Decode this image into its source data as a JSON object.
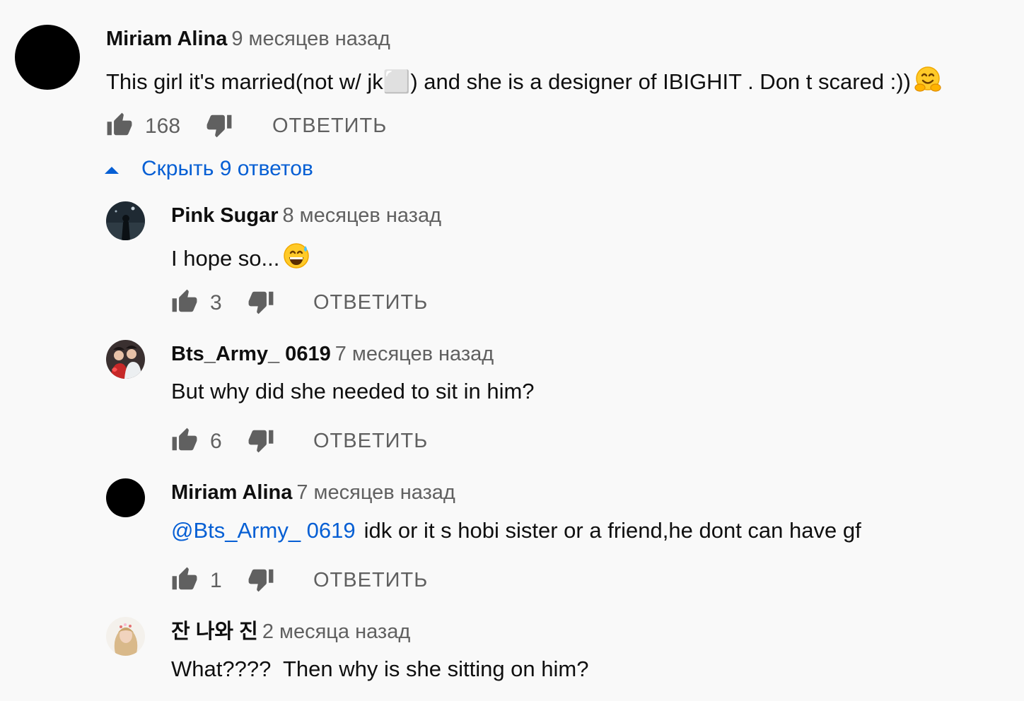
{
  "top_comment": {
    "author": "Miriam Alina",
    "time": "9 месяцев назад",
    "text": "This girl it's married(not w/ jk⬜) and she is a designer of IBIGHIT . Don t scared :))",
    "emoji": "hugging-face-emoji",
    "likes": "168",
    "reply_label": "ОТВЕТИТЬ"
  },
  "replies_toggle": {
    "label": "Скрыть 9 ответов"
  },
  "replies": [
    {
      "author": "Pink Sugar",
      "time": "8 месяцев назад",
      "text": "I hope so...",
      "emoji": "grinning-sweat-emoji",
      "likes": "3",
      "reply_label": "ОТВЕТИТЬ"
    },
    {
      "author": "Bts_Army_ 0619",
      "time": "7 месяцев назад",
      "text": "But why did she needed to sit in him?",
      "likes": "6",
      "reply_label": "ОТВЕТИТЬ"
    },
    {
      "author": "Miriam Alina",
      "time": "7 месяцев назад",
      "mention": "@Bts_Army_ 0619",
      "text": "idk or it s hobi sister or a friend,he dont can have gf",
      "likes": "1",
      "reply_label": "ОТВЕТИТЬ"
    },
    {
      "author": "잔 나와 진",
      "time": "2 месяца назад",
      "text": "What????  Then why is she sitting on him?"
    }
  ],
  "colors": {
    "background": "#f9f9f9",
    "link": "#065fd4",
    "secondary_text": "#606060",
    "primary_text": "#0f0f0f"
  },
  "icons": {
    "like": "thumb-up-icon",
    "dislike": "thumb-down-icon",
    "toggle": "caret-up-icon"
  }
}
